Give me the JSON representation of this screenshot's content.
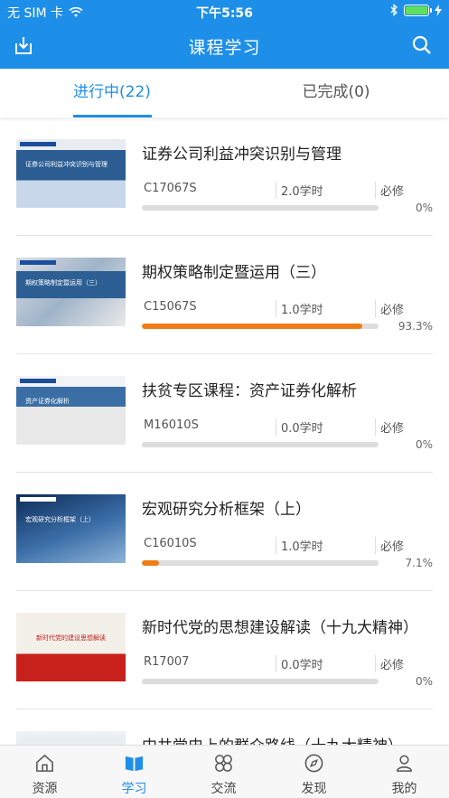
{
  "status_bar": {
    "carrier": "无 SIM 卡",
    "time": "下午5:56"
  },
  "nav": {
    "title": "课程学习",
    "download_icon": "download-icon",
    "search_icon": "search-icon"
  },
  "tabs": [
    {
      "label": "进行中(22)",
      "active": true
    },
    {
      "label": "已完成(0)",
      "active": false
    }
  ],
  "courses": [
    {
      "title": "证券公司利益冲突识别与管理",
      "code": "C17067S",
      "hours": "2.0学时",
      "required": "必修",
      "progress": 0,
      "progress_label": "0%",
      "thumb_text": "证券公司利益冲突识别与管理"
    },
    {
      "title": "期权策略制定暨运用（三）",
      "code": "C15067S",
      "hours": "1.0学时",
      "required": "必修",
      "progress": 0.933,
      "progress_label": "93.3%",
      "thumb_text": "期权策略制定暨运用（三）"
    },
    {
      "title": "扶贫专区课程：资产证券化解析",
      "code": "M16010S",
      "hours": "0.0学时",
      "required": "必修",
      "progress": 0,
      "progress_label": "0%",
      "thumb_text": "资产证券化解析"
    },
    {
      "title": "宏观研究分析框架（上）",
      "code": "C16010S",
      "hours": "1.0学时",
      "required": "必修",
      "progress": 0.071,
      "progress_label": "7.1%",
      "thumb_text": "宏观研究分析框架（上）"
    },
    {
      "title": "新时代党的思想建设解读（十九大精神）",
      "code": "R17007",
      "hours": "0.0学时",
      "required": "必修",
      "progress": 0,
      "progress_label": "0%",
      "thumb_text": "新时代党的建设思想解读"
    },
    {
      "title": "中共党史上的群众路线（十九大精神）",
      "code": "",
      "hours": "",
      "required": "",
      "progress": 0,
      "progress_label": "",
      "thumb_text": ""
    }
  ],
  "bottom_tabs": [
    {
      "label": "资源",
      "icon": "home-icon",
      "active": false
    },
    {
      "label": "学习",
      "icon": "book-icon",
      "active": true
    },
    {
      "label": "交流",
      "icon": "clover-icon",
      "active": false
    },
    {
      "label": "发现",
      "icon": "compass-icon",
      "active": false
    },
    {
      "label": "我的",
      "icon": "person-icon",
      "active": false
    }
  ],
  "colors": {
    "accent": "#1e8fe8",
    "progress": "#f07d14"
  }
}
